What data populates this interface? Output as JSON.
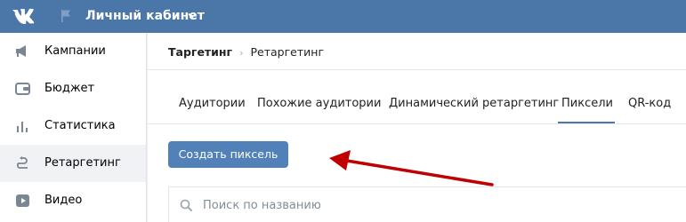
{
  "header": {
    "logo_icon": "vk-logo",
    "flag_icon": "flag-icon",
    "title": "Личный кабинет",
    "dropdown_icon": "chevron-down-icon"
  },
  "sidebar": {
    "items": [
      {
        "label": "Кампании",
        "icon": "megaphone-icon",
        "active": false
      },
      {
        "label": "Бюджет",
        "icon": "wallet-icon",
        "active": false
      },
      {
        "label": "Статистика",
        "icon": "bar-chart-icon",
        "active": false
      },
      {
        "label": "Ретаргетинг",
        "icon": "retarget-arrow-icon",
        "active": true
      },
      {
        "label": "Видео",
        "icon": "video-play-icon",
        "active": false
      }
    ]
  },
  "breadcrumb": {
    "root": "Таргетинг",
    "separator": "›",
    "current": "Ретаргетинг"
  },
  "tabs": [
    {
      "label": "Аудитории",
      "active": false
    },
    {
      "label": "Похожие аудитории",
      "active": false
    },
    {
      "label": "Динамический ретаргетинг",
      "active": false
    },
    {
      "label": "Пиксели",
      "active": true
    },
    {
      "label": "QR-код",
      "active": false
    }
  ],
  "create_button": {
    "label": "Создать пиксель"
  },
  "search": {
    "placeholder": "Поиск по названию",
    "value": ""
  },
  "colors": {
    "header_bg": "#4a76a8",
    "button_bg": "#5181b8",
    "annotation_arrow": "#c00000"
  }
}
